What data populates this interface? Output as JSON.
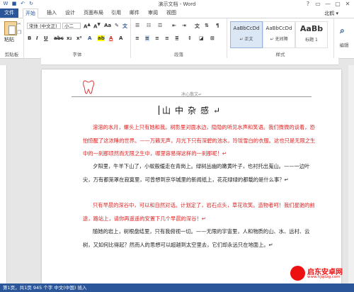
{
  "window": {
    "title": "演示文档 - Word",
    "controls": [
      "?",
      "▭",
      "—",
      "▢",
      "✕"
    ]
  },
  "tabs": [
    "开始",
    "插入",
    "设计",
    "页面布局",
    "引用",
    "邮件",
    "审阅",
    "视图"
  ],
  "file_tab": "文件",
  "user": "北鹤 ▾",
  "clipboard": {
    "paste": "粘贴",
    "label": "剪贴板"
  },
  "font": {
    "name": "宋体 (中文正)",
    "size": "小二",
    "label": "字体"
  },
  "paragraph": {
    "label": "段落"
  },
  "styles": {
    "label": "样式",
    "items": [
      {
        "sample": "AaBbCcDd",
        "name": "↵ 正文"
      },
      {
        "sample": "AaBbCcDd",
        "name": "↵ 无间隔"
      },
      {
        "sample": "AaBb",
        "name": "标题 1"
      }
    ]
  },
  "editing": {
    "label": "编辑"
  },
  "document": {
    "header": "冰心散文↵",
    "title": "山中杂感↵",
    "paragraphs": [
      "溶溶的水月，螺头上只有她和我。树影里对面水边，隐隐的听见水声和笑语。我们微微的谈着，恐怕惊醒了这浓睡的世界。——万籁无声，月光下只有深碧的池水，玲珑雪白的衣服。这也只是无限之生中的一刹那顷然而无限之生中，哪里容易得这样的一刹那呢！↵",
      "夕阳里，牛羊下山了，小蚁般缓走在青岗上。绿树丛幽的嫩黄叶子，也衬托出嵬山。——一边叶尖，万有都笼罩在寂寞里，可曾想到京华城里的新闻纸上，花花绿绿的都载的是什么事？↵",
      "只有早晨的深谷中，可以和自然对话。计划定了，岩石点头，草花欢笑。造物者呵！我们星驰的前途，路站上，请你再遥遥的安置下几个早晨的深谷！↵",
      "随她的岩上，树根盘结里，只有我俯视一切。——无限的宇宙里，人和物质的山、水、远村、云树，又如何比得起？然而人的思想可以超越到太空里去，它们却永远只在地面上。↵"
    ]
  },
  "status": "第1页，共1页  945 个字  中文(中国)  插入",
  "watermark": {
    "title": "启东安卓网",
    "url": "www.hjqdzg.com"
  }
}
